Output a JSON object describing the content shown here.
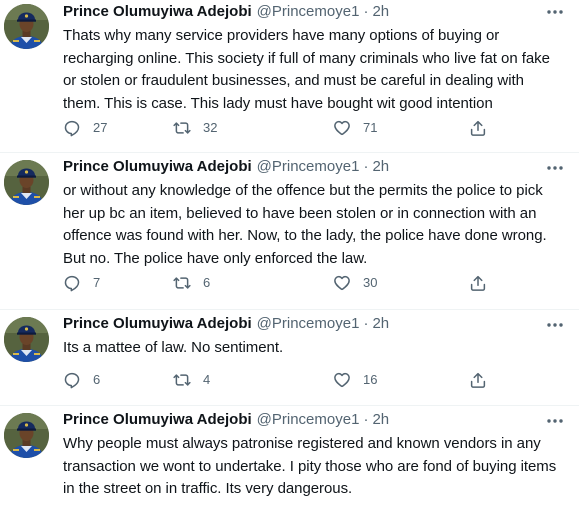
{
  "author": {
    "name": "Prince Olumuyiwa Adejobi",
    "handle": "@Princemoye1",
    "separator": "·"
  },
  "tweets": [
    {
      "time": "2h",
      "text": "Thats why many service providers have many options of buying or recharging online. This society if full of many criminals who live fat on fake or stolen or fraudulent businesses, and must be careful in dealing with them. This is case. This lady must have bought wit good intention",
      "replies": "27",
      "retweets": "32",
      "likes": "71"
    },
    {
      "time": "2h",
      "text": "or without any knowledge of the offence but the permits the police to pick her up bc an item, believed to have been stolen or in connection with an offence was found with her. Now, to the lady, the police have done wrong. But no. The police have only enforced the law.",
      "replies": "7",
      "retweets": "6",
      "likes": "30"
    },
    {
      "time": "2h",
      "text": "Its a mattee of law. No sentiment.",
      "replies": "6",
      "retweets": "4",
      "likes": "16"
    },
    {
      "time": "2h",
      "text": "Why people must always patronise registered and known vendors in any transaction we wont to undertake. I pity those who are fond of buying items in the street on in traffic. Its very dangerous."
    }
  ],
  "icons": {
    "more": "more-horizontal-icon",
    "reply": "reply-icon",
    "retweet": "retweet-icon",
    "like": "heart-icon",
    "share": "share-icon"
  },
  "colors": {
    "text": "#0f1419",
    "secondary": "#536471",
    "divider": "#eff3f4"
  }
}
